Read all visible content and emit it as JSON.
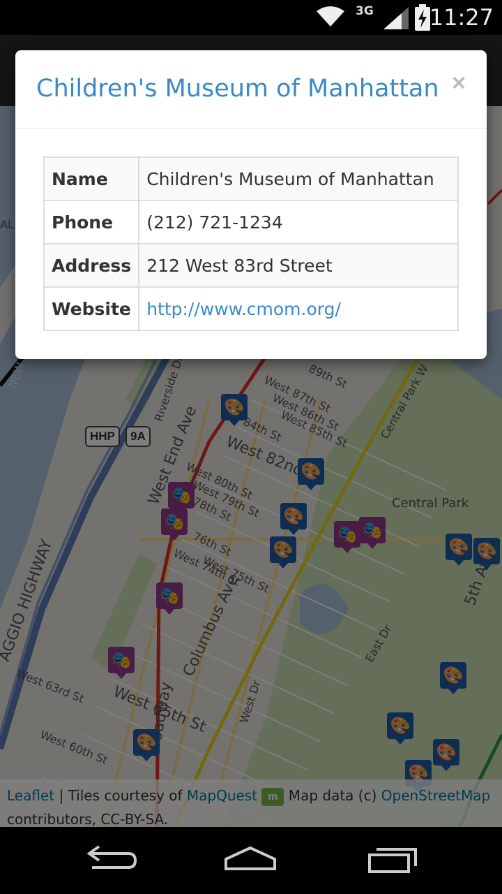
{
  "status_bar": {
    "time": "11:27",
    "network": "3G",
    "icons": [
      "wifi-icon",
      "signal-icon",
      "battery-charging-icon"
    ]
  },
  "map": {
    "labels": {
      "riverside": "Riverside Dr",
      "west_end_ave": "West End Ave",
      "broadway": "Broadway",
      "columbus_ave": "Columbus Ave",
      "central_park": "Central Park",
      "central_park_west": "Central Park W",
      "west_82nd": "West 82nd",
      "west_87th": "West 87th St",
      "west_86th": "West 86th St",
      "west_85th": "West 85th St",
      "w_84th": "84th St",
      "w_89th": "89th St",
      "w_80th": "West 80th St",
      "w_79th": "West 79th St",
      "w_78th": "78th St",
      "w_76th": "76th St",
      "w_74th": "West 74th St",
      "w_75th": "West 75th St",
      "w_63rd": "West 63rd St",
      "w_60th": "West 60th St",
      "west_65th": "West 65th St",
      "west_dr": "West Dr",
      "east_dr": "East Dr",
      "fifth_ave": "5th Av",
      "highway": "AGGIO HIGHWAY",
      "hhp": "HHP",
      "route_9a": "9A",
      "al": "AL",
      "new_jersey": "NEW"
    },
    "attribution": {
      "leaflet": "Leaflet",
      "tiles_text": " | Tiles courtesy of ",
      "mapquest": "MapQuest",
      "mq_logo": "m",
      "data_text": " Map data (c) ",
      "osm": "OpenStreetMap",
      "license": "contributors, CC-BY-SA."
    }
  },
  "modal": {
    "title": "Children's Museum of Manhattan",
    "close_label": "×",
    "rows": [
      {
        "key": "Name",
        "value": "Children's Museum of Manhattan"
      },
      {
        "key": "Phone",
        "value": "(212) 721-1234"
      },
      {
        "key": "Address",
        "value": "212 West 83rd Street"
      },
      {
        "key": "Website",
        "value": "http://www.cmom.org/"
      }
    ]
  },
  "nav_bar": {
    "buttons": [
      "back-icon",
      "home-icon",
      "recent-apps-icon"
    ]
  },
  "colors": {
    "title_blue": "#3a8ac8",
    "art_marker": "#1f5ba6",
    "theater_marker": "#8e3a8c",
    "subway_red": "#d8322c",
    "subway_yellow": "#e2d21f"
  }
}
